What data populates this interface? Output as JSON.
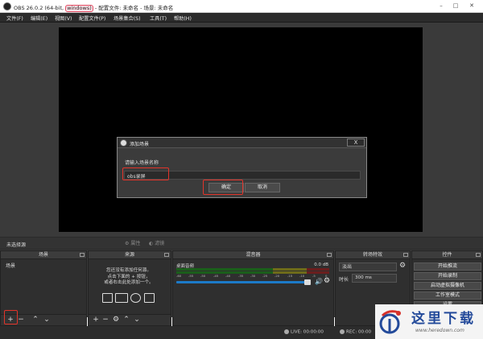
{
  "window": {
    "title_prefix": "OBS 26.0.2 (64-bit, ",
    "title_highlight": "windows)",
    "title_suffix": " - 配置文件: 未命名 - 场景: 未命名"
  },
  "menu": [
    "文件(F)",
    "编辑(E)",
    "视图(V)",
    "配置文件(P)",
    "场景集合(S)",
    "工具(T)",
    "帮助(H)"
  ],
  "dialog": {
    "title": "添加场景",
    "close_label": "X",
    "prompt": "请输入场景名称",
    "input_value": "obs录屏",
    "ok_label": "确定",
    "cancel_label": "取消"
  },
  "status_strip": {
    "no_source": "未选择源",
    "properties": "属性",
    "filters": "滤镜"
  },
  "docks": {
    "scenes": {
      "title": "场景",
      "items": [
        "场景"
      ]
    },
    "sources": {
      "title": "来源",
      "hint_lines": [
        "您还没有添加任何源。",
        "点击下面的 + 按钮，",
        "或者右击此处添加一个。"
      ]
    },
    "mixer": {
      "title": "混音器",
      "source_name": "桌面音频",
      "db_value": "0.0 dB",
      "scale_ticks": [
        "-60",
        "-55",
        "-50",
        "-45",
        "-40",
        "-35",
        "-30",
        "-25",
        "-20",
        "-15",
        "-10",
        "-5",
        "0"
      ],
      "volume_fraction": 1.0
    },
    "transitions": {
      "title": "转场特效",
      "selected": "淡出",
      "duration_label": "时长",
      "duration_value": "300 ms"
    },
    "controls": {
      "title": "控件",
      "buttons": [
        "开始推流",
        "开始录制",
        "启动虚拟摄像机",
        "工作室模式",
        "设置"
      ]
    }
  },
  "bottom_status": {
    "live": "LIVE: 00:00:00",
    "rec": "REC: 00:00"
  },
  "watermark": {
    "brand_cn": "这里下载",
    "url": "www.heredown.com"
  },
  "colors": {
    "highlight_box": "#e2342a",
    "panel_bg": "#2f2f2f",
    "volume_blue": "#1c7ac8",
    "brand_blue": "#234a9a"
  }
}
